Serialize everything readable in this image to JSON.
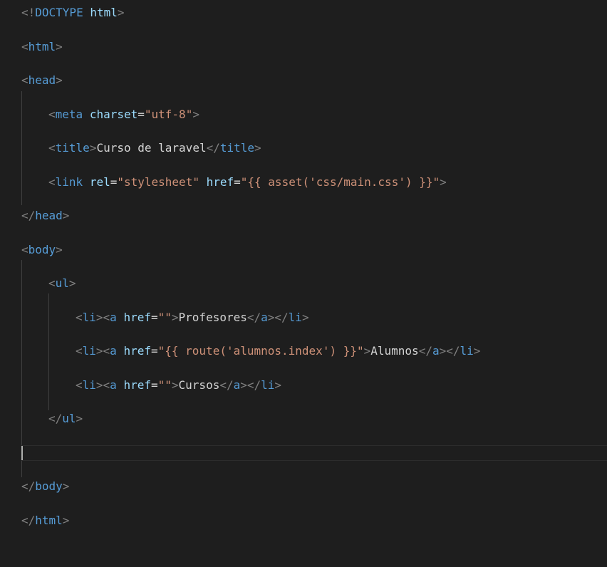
{
  "editor": {
    "lines": [
      {
        "indent": 0,
        "tokens": [
          [
            "punct",
            "<!"
          ],
          [
            "tag",
            "DOCTYPE"
          ],
          [
            "txt",
            " "
          ],
          [
            "attr",
            "html"
          ],
          [
            "punct",
            ">"
          ]
        ]
      },
      {
        "indent": 0,
        "tokens": [
          [
            "punct",
            "<"
          ],
          [
            "tag",
            "html"
          ],
          [
            "punct",
            ">"
          ]
        ]
      },
      {
        "indent": 0,
        "tokens": [
          [
            "punct",
            "<"
          ],
          [
            "tag",
            "head"
          ],
          [
            "punct",
            ">"
          ]
        ]
      },
      {
        "indent": 1,
        "tokens": [
          [
            "punct",
            "<"
          ],
          [
            "tag",
            "meta"
          ],
          [
            "txt",
            " "
          ],
          [
            "attr",
            "charset"
          ],
          [
            "txt",
            "="
          ],
          [
            "str",
            "\"utf-8\""
          ],
          [
            "punct",
            ">"
          ]
        ]
      },
      {
        "indent": 1,
        "tokens": [
          [
            "punct",
            "<"
          ],
          [
            "tag",
            "title"
          ],
          [
            "punct",
            ">"
          ],
          [
            "txt",
            "Curso de laravel"
          ],
          [
            "punct",
            "</"
          ],
          [
            "tag",
            "title"
          ],
          [
            "punct",
            ">"
          ]
        ]
      },
      {
        "indent": 1,
        "tokens": [
          [
            "punct",
            "<"
          ],
          [
            "tag",
            "link"
          ],
          [
            "txt",
            " "
          ],
          [
            "attr",
            "rel"
          ],
          [
            "txt",
            "="
          ],
          [
            "str",
            "\"stylesheet\""
          ],
          [
            "txt",
            " "
          ],
          [
            "attr",
            "href"
          ],
          [
            "txt",
            "="
          ],
          [
            "str",
            "\"{{ asset('css/main.css') }}\""
          ],
          [
            "punct",
            ">"
          ]
        ]
      },
      {
        "indent": 0,
        "tokens": [
          [
            "punct",
            "</"
          ],
          [
            "tag",
            "head"
          ],
          [
            "punct",
            ">"
          ]
        ]
      },
      {
        "indent": 0,
        "tokens": [
          [
            "punct",
            "<"
          ],
          [
            "tag",
            "body"
          ],
          [
            "punct",
            ">"
          ]
        ]
      },
      {
        "indent": 1,
        "tokens": [
          [
            "punct",
            "<"
          ],
          [
            "tag",
            "ul"
          ],
          [
            "punct",
            ">"
          ]
        ]
      },
      {
        "indent": 2,
        "tokens": [
          [
            "punct",
            "<"
          ],
          [
            "tag",
            "li"
          ],
          [
            "punct",
            "><"
          ],
          [
            "tag",
            "a"
          ],
          [
            "txt",
            " "
          ],
          [
            "attr",
            "href"
          ],
          [
            "txt",
            "="
          ],
          [
            "str",
            "\"\""
          ],
          [
            "punct",
            ">"
          ],
          [
            "txt",
            "Profesores"
          ],
          [
            "punct",
            "</"
          ],
          [
            "tag",
            "a"
          ],
          [
            "punct",
            "></"
          ],
          [
            "tag",
            "li"
          ],
          [
            "punct",
            ">"
          ]
        ]
      },
      {
        "indent": 2,
        "tokens": [
          [
            "punct",
            "<"
          ],
          [
            "tag",
            "li"
          ],
          [
            "punct",
            "><"
          ],
          [
            "tag",
            "a"
          ],
          [
            "txt",
            " "
          ],
          [
            "attr",
            "href"
          ],
          [
            "txt",
            "="
          ],
          [
            "str",
            "\"{{ route('alumnos.index') }}\""
          ],
          [
            "punct",
            ">"
          ],
          [
            "txt",
            "Alumnos"
          ],
          [
            "punct",
            "</"
          ],
          [
            "tag",
            "a"
          ],
          [
            "punct",
            "></"
          ],
          [
            "tag",
            "li"
          ],
          [
            "punct",
            ">"
          ]
        ]
      },
      {
        "indent": 2,
        "tokens": [
          [
            "punct",
            "<"
          ],
          [
            "tag",
            "li"
          ],
          [
            "punct",
            "><"
          ],
          [
            "tag",
            "a"
          ],
          [
            "txt",
            " "
          ],
          [
            "attr",
            "href"
          ],
          [
            "txt",
            "="
          ],
          [
            "str",
            "\"\""
          ],
          [
            "punct",
            ">"
          ],
          [
            "txt",
            "Cursos"
          ],
          [
            "punct",
            "</"
          ],
          [
            "tag",
            "a"
          ],
          [
            "punct",
            "></"
          ],
          [
            "tag",
            "li"
          ],
          [
            "punct",
            ">"
          ]
        ]
      },
      {
        "indent": 1,
        "tokens": [
          [
            "punct",
            "</"
          ],
          [
            "tag",
            "ul"
          ],
          [
            "punct",
            ">"
          ]
        ]
      },
      {
        "indent": 0,
        "tokens": []
      },
      {
        "indent": 0,
        "tokens": [
          [
            "punct",
            "</"
          ],
          [
            "tag",
            "body"
          ],
          [
            "punct",
            ">"
          ]
        ]
      },
      {
        "indent": 0,
        "tokens": [
          [
            "punct",
            "</"
          ],
          [
            "tag",
            "html"
          ],
          [
            "punct",
            ">"
          ]
        ]
      }
    ]
  },
  "colors": {
    "background": "#1e1e1e",
    "punctuation": "#808080",
    "tag": "#569cd6",
    "attribute": "#9cdcfe",
    "string": "#ce9178",
    "text": "#d4d4d4"
  }
}
